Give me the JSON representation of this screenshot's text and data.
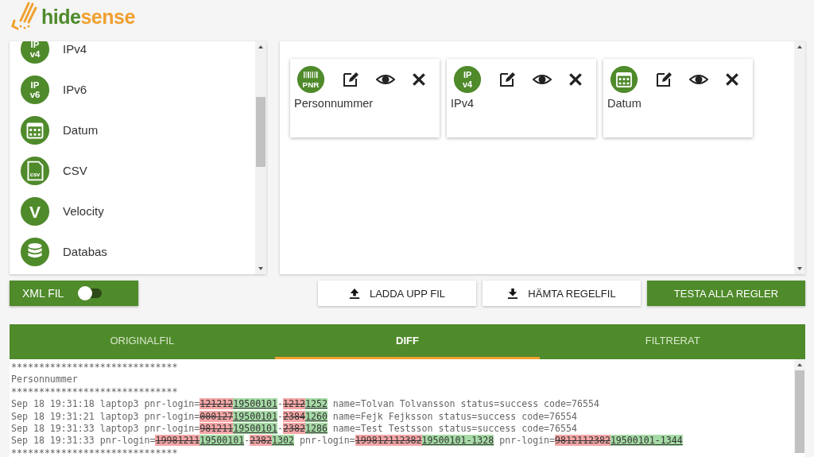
{
  "logo": {
    "part_1": "hide",
    "part_2": "sense"
  },
  "rule_types": [
    {
      "label": "IPv4",
      "kind": "text",
      "icon_text": [
        "IP",
        "v4"
      ]
    },
    {
      "label": "IPv6",
      "kind": "text",
      "icon_text": [
        "IP",
        "v6"
      ]
    },
    {
      "label": "Datum",
      "kind": "calendar"
    },
    {
      "label": "CSV",
      "kind": "doc",
      "icon_text": [
        "csv"
      ]
    },
    {
      "label": "Velocity",
      "kind": "text",
      "icon_text": [
        "V"
      ]
    },
    {
      "label": "Databas",
      "kind": "database"
    }
  ],
  "rules": [
    {
      "label": "Personnummer",
      "kind": "barcode",
      "icon_text": [
        "PNR"
      ]
    },
    {
      "label": "IPv4",
      "kind": "text",
      "icon_text": [
        "IP",
        "v4"
      ]
    },
    {
      "label": "Datum",
      "kind": "calendar"
    }
  ],
  "xml_toggle": {
    "label": "XML FIL",
    "on": false
  },
  "buttons": [
    {
      "label": "LADDA UPP FIL",
      "kind": "upload"
    },
    {
      "label": "HÄMTA REGELFIL",
      "kind": "download"
    },
    {
      "label": "TESTA ALLA REGLER",
      "kind": "primary"
    }
  ],
  "tabs": [
    {
      "label": "ORIGINALFIL",
      "selected": false
    },
    {
      "label": "DIFF",
      "selected": true
    },
    {
      "label": "FILTRERAT",
      "selected": false
    }
  ],
  "diff_lines": [
    [
      {
        "kind": "plain",
        "text": "******************************"
      }
    ],
    [
      {
        "kind": "plain",
        "text": "Personnummer"
      }
    ],
    [
      {
        "kind": "plain",
        "text": "******************************"
      }
    ],
    [
      {
        "kind": "plain",
        "text": "Sep 18 19:31:18 laptop3 pnr-login="
      },
      {
        "kind": "del",
        "text": "121212"
      },
      {
        "kind": "ins",
        "text": "19500101"
      },
      {
        "kind": "plain",
        "text": "-"
      },
      {
        "kind": "del",
        "text": "1212"
      },
      {
        "kind": "ins",
        "text": "1252"
      },
      {
        "kind": "plain",
        "text": " name=Tolvan Tolvansson status=success code=76554"
      }
    ],
    [
      {
        "kind": "plain",
        "text": "Sep 18 19:31:21 laptop3 pnr-login="
      },
      {
        "kind": "del",
        "text": "000127"
      },
      {
        "kind": "ins",
        "text": "19500101"
      },
      {
        "kind": "plain",
        "text": "-"
      },
      {
        "kind": "del",
        "text": "2384"
      },
      {
        "kind": "ins",
        "text": "1260"
      },
      {
        "kind": "plain",
        "text": " name=Fejk Fejksson status=success code=76554"
      }
    ],
    [
      {
        "kind": "plain",
        "text": "Sep 18 19:31:33 laptop3 pnr-login="
      },
      {
        "kind": "del",
        "text": "981211"
      },
      {
        "kind": "ins",
        "text": "19500101"
      },
      {
        "kind": "plain",
        "text": "-"
      },
      {
        "kind": "del",
        "text": "2382"
      },
      {
        "kind": "ins",
        "text": "1286"
      },
      {
        "kind": "plain",
        "text": " name=Test Testsson status=success code=76554"
      }
    ],
    [
      {
        "kind": "plain",
        "text": "Sep 18 19:31:33 pnr-login="
      },
      {
        "kind": "del",
        "text": "19981211"
      },
      {
        "kind": "ins",
        "text": "19500101"
      },
      {
        "kind": "plain",
        "text": "-"
      },
      {
        "kind": "del",
        "text": "2382"
      },
      {
        "kind": "ins",
        "text": "1302"
      },
      {
        "kind": "plain",
        "text": " pnr-login="
      },
      {
        "kind": "del",
        "text": "199812112382"
      },
      {
        "kind": "ins",
        "text": "19500101-1328"
      },
      {
        "kind": "plain",
        "text": " pnr-login="
      },
      {
        "kind": "del",
        "text": "9812112382"
      },
      {
        "kind": "ins",
        "text": "19500101-1344"
      }
    ],
    [
      {
        "kind": "plain",
        "text": "******************************"
      }
    ]
  ]
}
